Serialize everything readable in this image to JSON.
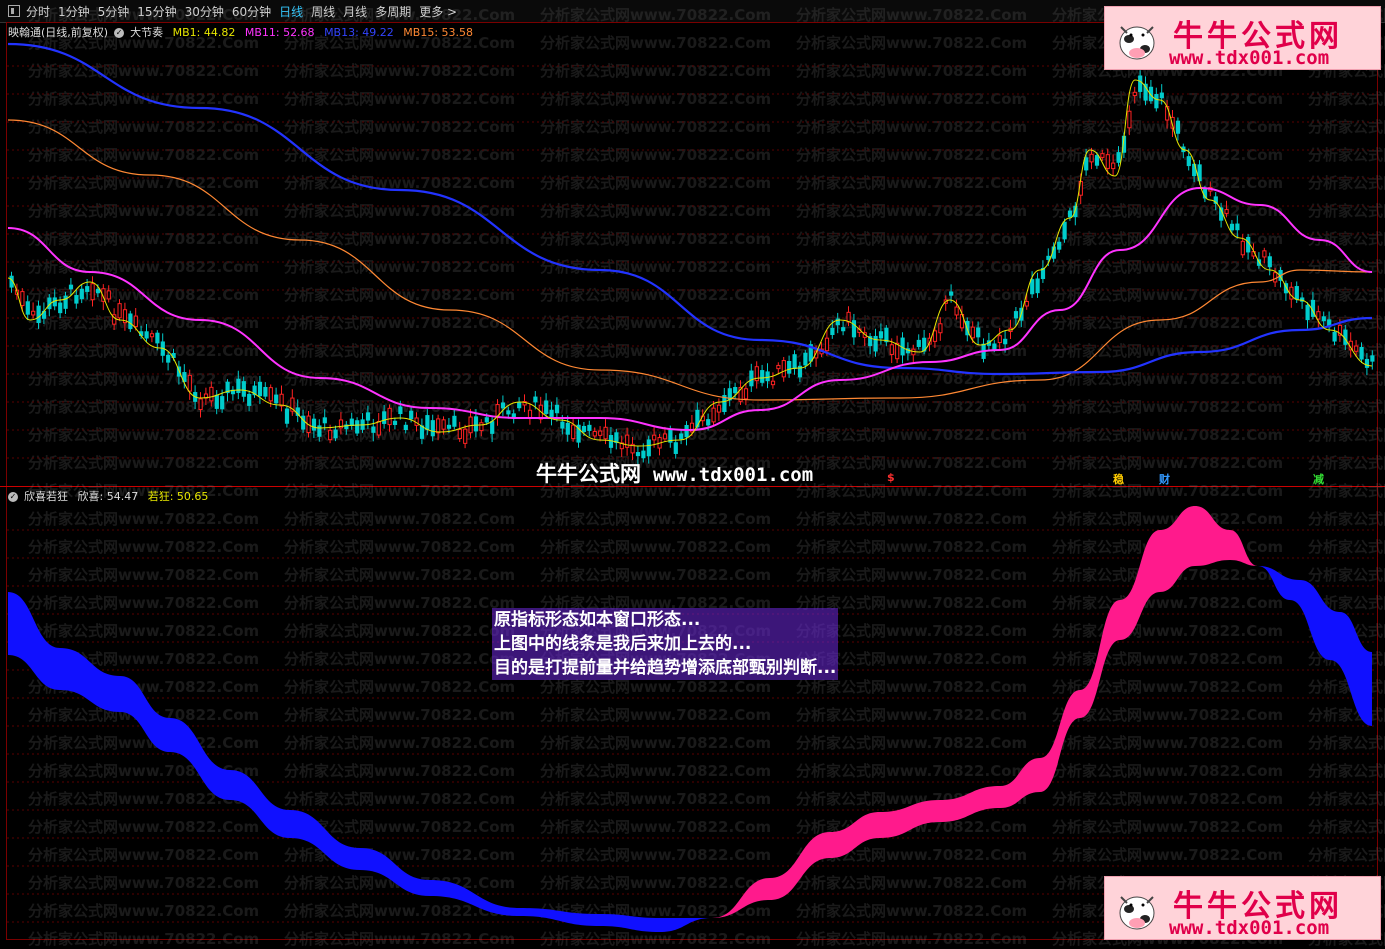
{
  "toolbar": {
    "periods": [
      "分时",
      "1分钟",
      "5分钟",
      "15分钟",
      "30分钟",
      "60分钟",
      "日线",
      "周线",
      "月线",
      "多周期",
      "更多 >"
    ],
    "active": "日线"
  },
  "upper": {
    "title": "映翰通(日线,前复权)",
    "indicator": "大节奏",
    "mb1_label": "MB1: 44.82",
    "mb11_label": "MB11: 52.68",
    "mb13_label": "MB13: 49.22",
    "mb15_label": "MB15: 53.58",
    "colors": {
      "mb1": "#e6e600",
      "mb11": "#ff33ff",
      "mb13": "#2233ff",
      "mb15": "#ff8833",
      "up": "#ff2222",
      "down": "#00cccc"
    },
    "markers": [
      {
        "text": "$",
        "color": "#ff3030"
      },
      {
        "text": "稳",
        "color": "#ffcc00"
      },
      {
        "text": "财",
        "color": "#3399ff"
      },
      {
        "text": "减",
        "color": "#33dd33"
      }
    ]
  },
  "lower": {
    "title": "欣喜若狂",
    "xinxi_label": "欣喜: 54.47",
    "ruokuang_label": "若狂: 50.65",
    "colors": {
      "rise": "#ff1a8c",
      "fall": "#1010ff"
    }
  },
  "annotation": {
    "lines": [
      "原指标形态如本窗口形态...",
      "上图中的线条是我后来加上去的...",
      "目的是打提前量并给趋势增添底部甄别判断..."
    ]
  },
  "branding": {
    "logo_title": "牛牛公式网",
    "logo_url": "www.tdx001.com",
    "center_name": "牛牛公式网",
    "center_url": "www.tdx001.com",
    "watermark": "分析家公式网www.70822.Com"
  }
}
